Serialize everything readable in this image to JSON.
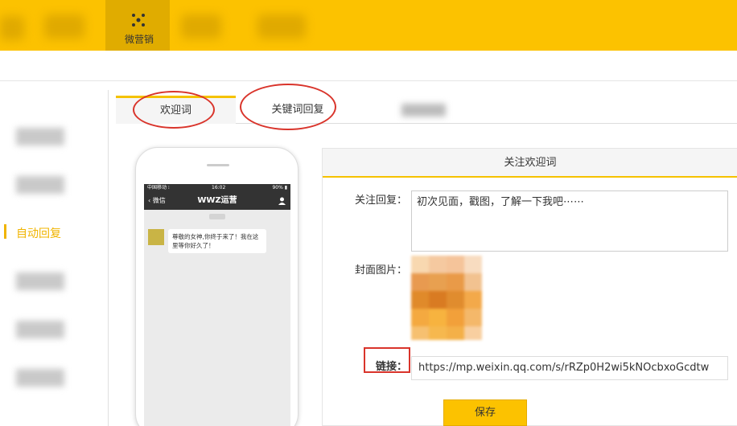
{
  "topnav": {
    "active_label": "微营销",
    "active_icon": "dots-cluster-icon"
  },
  "sidebar": {
    "active_item": "自动回复"
  },
  "tabs": [
    {
      "label": "欢迎词",
      "active": true
    },
    {
      "label": "关键词回复",
      "active": false
    }
  ],
  "phone": {
    "status": {
      "carrier": "中国移动 ⁝",
      "time": "16:02",
      "battery": "90% ▮"
    },
    "nav": {
      "back_label": "微信",
      "title": "WWZ运营"
    },
    "message": "尊敬的女神,你终于来了！我在这里等你好久了！"
  },
  "panel": {
    "title": "关注欢迎词",
    "reply_label": "关注回复：",
    "reply_text": "初次见面，戳图，了解一下我吧⋯⋯",
    "cover_label": "封面图片：",
    "link_label": "链接：",
    "link_value": "https://mp.weixin.qq.com/s/rRZp0H2wi5kNOcbxoGcdtw",
    "save_label": "保存"
  },
  "colors": {
    "brand_yellow": "#fcc200",
    "annotation_red": "#d9342b",
    "active_text": "#f0b400"
  }
}
